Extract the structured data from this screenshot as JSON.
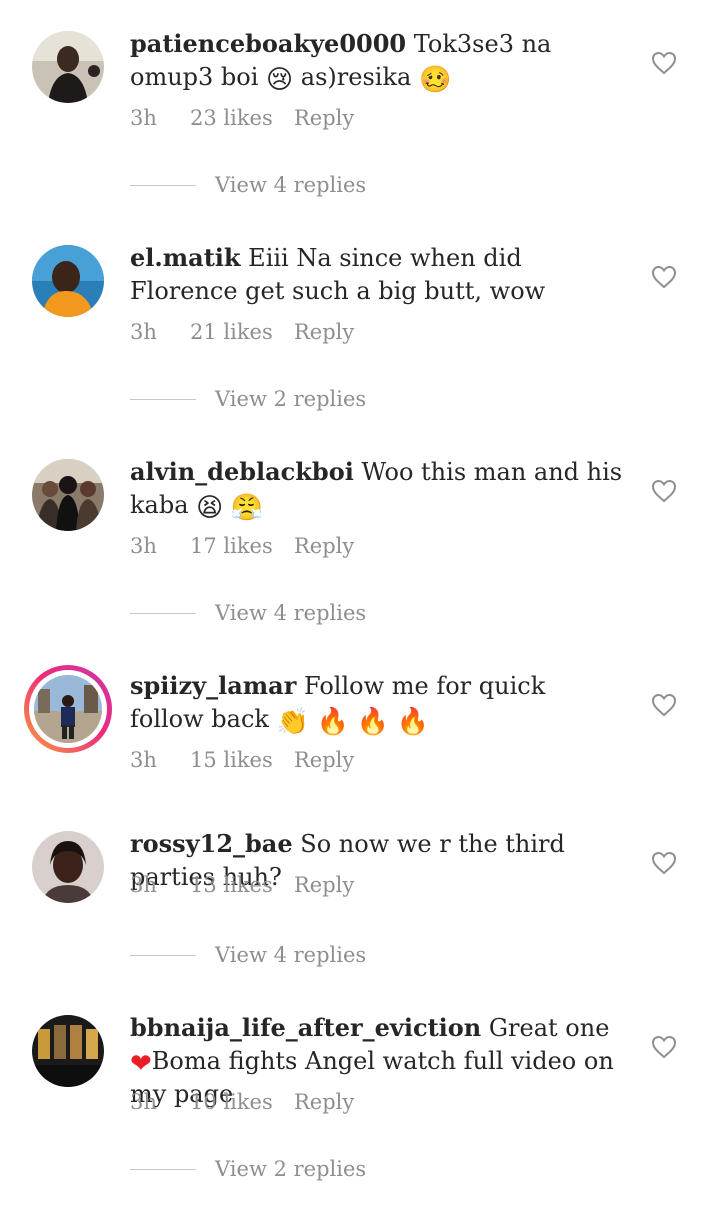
{
  "labels": {
    "reply": "Reply"
  },
  "comments": [
    {
      "username": "patienceboakye0000",
      "text_parts": [
        "Tok3se3 na omup3 boi ",
        "as)resika "
      ],
      "emojis": [
        "😢",
        "🥴"
      ],
      "time": "3h",
      "likes": "23 likes",
      "view_replies": "View 4 replies"
    },
    {
      "username": "el.matik",
      "text": "Eiii Na since when did Florence get such a big butt, wow",
      "time": "3h",
      "likes": "21 likes",
      "view_replies": "View 2 replies"
    },
    {
      "username": "alvin_deblackboi",
      "text": "Woo this man and his kaba ",
      "emojis": [
        "😫",
        "😤"
      ],
      "time": "3h",
      "likes": "17 likes",
      "view_replies": "View 4 replies"
    },
    {
      "username": "spiizy_lamar",
      "text": "Follow me for quick follow back",
      "emojis": [
        "👏",
        "🔥",
        "🔥",
        "🔥"
      ],
      "time": "3h",
      "likes": "15 likes"
    },
    {
      "username": "rossy12_bae",
      "text": "So now we r the third parties huh?",
      "time": "3h",
      "likes": "13 likes",
      "view_replies": "View 4 replies"
    },
    {
      "username": "bbnaija_life_after_eviction",
      "text_parts": [
        "Great one",
        "Boma fights Angel watch full video on my page"
      ],
      "emojis": [
        "❤"
      ],
      "time": "3h",
      "likes": "10 likes",
      "view_replies": "View 2 replies"
    }
  ],
  "colors": {
    "text": "#262626",
    "muted": "#8e8e8e",
    "divider": "#c7c7c7",
    "heart_red": "#ed1c24",
    "story_ring": [
      "#f9a23c",
      "#ee2a7b",
      "#c837ab"
    ]
  },
  "icons": {
    "like": "heart-outline-icon",
    "inline_heart": "red-heart-emoji"
  }
}
